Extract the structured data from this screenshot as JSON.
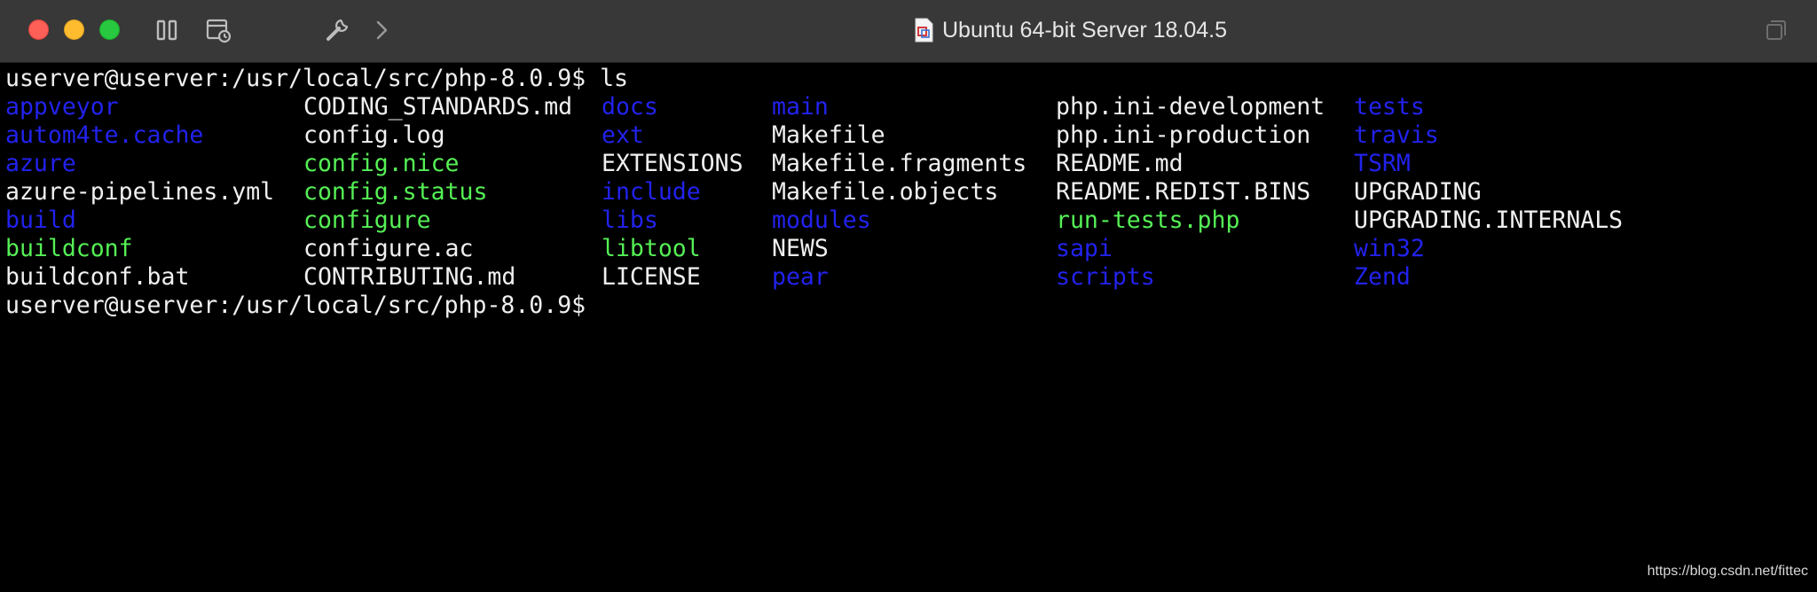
{
  "window": {
    "title": "Ubuntu 64-bit Server 18.04.5"
  },
  "colors": {
    "directory": "#2222ee",
    "executable": "#55f055",
    "file": "#f0f0f0"
  },
  "terminal": {
    "prompt_line": "userver@userver:/usr/local/src/php-8.0.9$ ls",
    "final_prompt": "userver@userver:/usr/local/src/php-8.0.9$",
    "rows": [
      [
        {
          "text": "appveyor",
          "kind": "dir"
        },
        {
          "text": "CODING_STANDARDS.md",
          "kind": "file"
        },
        {
          "text": "docs",
          "kind": "dir"
        },
        {
          "text": "main",
          "kind": "dir"
        },
        {
          "text": "php.ini-development",
          "kind": "file"
        },
        {
          "text": "tests",
          "kind": "dir"
        }
      ],
      [
        {
          "text": "autom4te.cache",
          "kind": "dir"
        },
        {
          "text": "config.log",
          "kind": "file"
        },
        {
          "text": "ext",
          "kind": "dir"
        },
        {
          "text": "Makefile",
          "kind": "file"
        },
        {
          "text": "php.ini-production",
          "kind": "file"
        },
        {
          "text": "travis",
          "kind": "dir"
        }
      ],
      [
        {
          "text": "azure",
          "kind": "dir"
        },
        {
          "text": "config.nice",
          "kind": "exec"
        },
        {
          "text": "EXTENSIONS",
          "kind": "file"
        },
        {
          "text": "Makefile.fragments",
          "kind": "file"
        },
        {
          "text": "README.md",
          "kind": "file"
        },
        {
          "text": "TSRM",
          "kind": "dir"
        }
      ],
      [
        {
          "text": "azure-pipelines.yml",
          "kind": "file"
        },
        {
          "text": "config.status",
          "kind": "exec"
        },
        {
          "text": "include",
          "kind": "dir"
        },
        {
          "text": "Makefile.objects",
          "kind": "file"
        },
        {
          "text": "README.REDIST.BINS",
          "kind": "file"
        },
        {
          "text": "UPGRADING",
          "kind": "file"
        }
      ],
      [
        {
          "text": "build",
          "kind": "dir"
        },
        {
          "text": "configure",
          "kind": "exec"
        },
        {
          "text": "libs",
          "kind": "dir"
        },
        {
          "text": "modules",
          "kind": "dir"
        },
        {
          "text": "run-tests.php",
          "kind": "exec"
        },
        {
          "text": "UPGRADING.INTERNALS",
          "kind": "file"
        }
      ],
      [
        {
          "text": "buildconf",
          "kind": "exec"
        },
        {
          "text": "configure.ac",
          "kind": "file"
        },
        {
          "text": "libtool",
          "kind": "exec"
        },
        {
          "text": "NEWS",
          "kind": "file"
        },
        {
          "text": "sapi",
          "kind": "dir"
        },
        {
          "text": "win32",
          "kind": "dir"
        }
      ],
      [
        {
          "text": "buildconf.bat",
          "kind": "file"
        },
        {
          "text": "CONTRIBUTING.md",
          "kind": "file"
        },
        {
          "text": "LICENSE",
          "kind": "file"
        },
        {
          "text": "pear",
          "kind": "dir"
        },
        {
          "text": "scripts",
          "kind": "dir"
        },
        {
          "text": "Zend",
          "kind": "dir"
        }
      ]
    ]
  },
  "icons": [
    "close-button",
    "minimize-button",
    "maximize-button",
    "pause-icon",
    "snapshot-icon",
    "settings-wrench-icon",
    "chevron-right-icon",
    "document-icon",
    "window-copy-icon"
  ],
  "watermark": "https://blog.csdn.net/fittec"
}
